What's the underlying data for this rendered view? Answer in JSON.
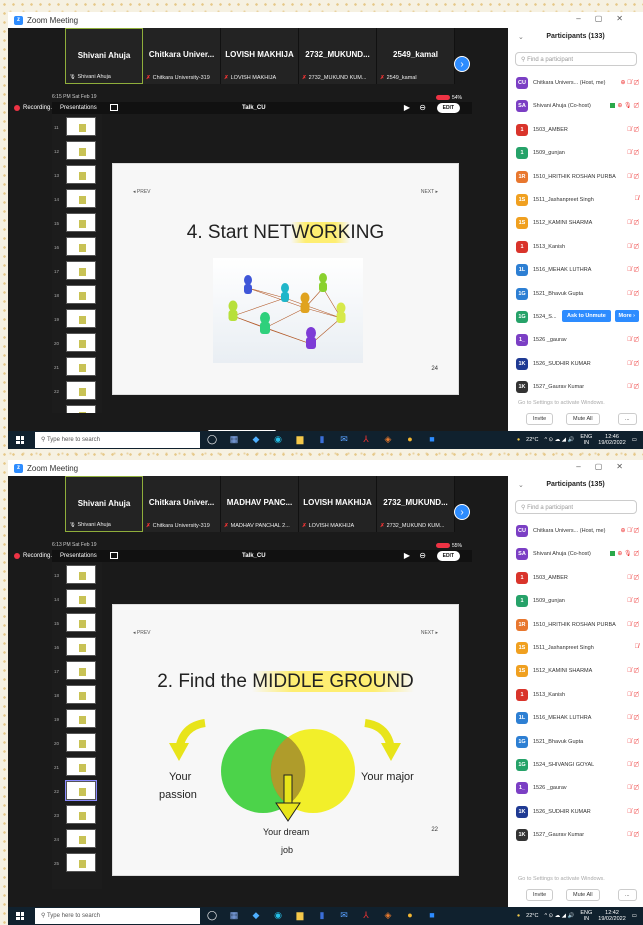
{
  "window_title": "Zoom Meeting",
  "shots": [
    {
      "thumbs": [
        {
          "name": "Shivani Ahuja",
          "sub": "Shivani Ahuja",
          "muted": false
        },
        {
          "name": "Chitkara Univer...",
          "sub": "Chitkara University-319",
          "muted": true
        },
        {
          "name": "LOVISH MAKHIJA",
          "sub": "LOVISH MAKHIJA",
          "muted": true
        },
        {
          "name": "2732_MUKUND...",
          "sub": "2732_MUKUND KUM...",
          "muted": true
        },
        {
          "name": "2549_kamal",
          "sub": "2549_kamal",
          "muted": true
        }
      ],
      "recording": "Recording...",
      "tablet_time": "6:15 PM  Sat Feb 19",
      "tablet_battery": "54%",
      "presentations_label": "Presentations",
      "doc_title": "Talk_CU",
      "edit_label": "EDIT",
      "slide_numbers": [
        "11",
        "12",
        "13",
        "14",
        "15",
        "16",
        "17",
        "18",
        "19",
        "20",
        "21",
        "22",
        "23",
        "24",
        "25"
      ],
      "selected_slide": 13,
      "slide": {
        "prev": "◂  PREV",
        "next": "NEXT  ▸",
        "heading_a": "4. Start NET",
        "heading_hl": "WORK",
        "heading_b": "ING",
        "page": "24"
      },
      "participants_title": "Participants (133)",
      "search_placeholder": "Find a participant",
      "participants": [
        {
          "initials": "CU",
          "color": "#7b3fc4",
          "name": "Chitkara Univers... (Host, me)",
          "icons": "⊕ 🎙̸ ▢̸"
        },
        {
          "initials": "SA",
          "color": "#7b3fc4",
          "name": "Shivani Ahuja (Co-host)",
          "icons": "⊕ 🎙 ▢̸",
          "green": true
        },
        {
          "initials": "1",
          "color": "#d9342b",
          "name": "1503_AMBER",
          "icons": "🎙̸ ▢̸"
        },
        {
          "initials": "1",
          "color": "#26a269",
          "name": "1509_gunjan",
          "icons": "🎙̸ ▢̸"
        },
        {
          "initials": "1R",
          "color": "#e8772e",
          "name": "1510_HRITHIK ROSHAN PURBA",
          "icons": "🎙̸ ▢̸"
        },
        {
          "initials": "1S",
          "color": "#f0a020",
          "name": "1511_Jashanpreet Singh",
          "icons": "🎙̸"
        },
        {
          "initials": "1S",
          "color": "#f0a020",
          "name": "1512_KAMINI SHARMA",
          "icons": "🎙̸ ▢̸"
        },
        {
          "initials": "1",
          "color": "#d9342b",
          "name": "1513_Kanish",
          "icons": "🎙̸ ▢̸"
        },
        {
          "initials": "1L",
          "color": "#2d7fd3",
          "name": "1516_MEHAK LUTHRA",
          "icons": "🎙̸ ▢̸"
        },
        {
          "initials": "1G",
          "color": "#2d7fd3",
          "name": "1521_Bhavuk Gupta",
          "icons": "🎙̸ ▢̸"
        },
        {
          "initials": "1G",
          "color": "#26a269",
          "name": "1524_S...",
          "icons": "",
          "unmute": "Ask to Unmute",
          "more": "More ›"
        },
        {
          "initials": "1_",
          "color": "#7b3fc4",
          "name": "1526 _gaurav",
          "icons": "🎙̸ ▢̸"
        },
        {
          "initials": "1K",
          "color": "#1f3a93",
          "name": "1526_SUDHIR KUMAR",
          "icons": "🎙̸ ▢̸"
        },
        {
          "initials": "1K",
          "color": "#333333",
          "name": "1527_Gaurav Kumar",
          "icons": "🎙̸ ▢̸"
        }
      ],
      "watermark": "Go to Settings to activate Windows.",
      "invite": "Invite",
      "muteall": "Mute All",
      "more_dots": "...",
      "taskbar_search": "Type here to search",
      "weather": "22°C",
      "lang": "ENG",
      "lang2": "IN",
      "time": "12:46",
      "date": "19/02/2022"
    },
    {
      "thumbs": [
        {
          "name": "Shivani Ahuja",
          "sub": "Shivani Ahuja",
          "muted": false
        },
        {
          "name": "Chitkara Univer...",
          "sub": "Chitkara University-319",
          "muted": true
        },
        {
          "name": "MADHAV PANC...",
          "sub": "MADHAV PANCHAL 2...",
          "muted": true
        },
        {
          "name": "LOVISH MAKHIJA",
          "sub": "LOVISH MAKHIJA",
          "muted": true
        },
        {
          "name": "2732_MUKUND...",
          "sub": "2732_MUKUND KUM...",
          "muted": true
        }
      ],
      "recording": "Recording...",
      "tablet_time": "6:13 PM  Sat Feb 19",
      "tablet_battery": "55%",
      "presentations_label": "Presentations",
      "doc_title": "Talk_CU",
      "edit_label": "EDIT",
      "slide_numbers": [
        "13",
        "14",
        "15",
        "16",
        "17",
        "18",
        "19",
        "20",
        "21",
        "22",
        "23",
        "24",
        "25"
      ],
      "selected_slide": 9,
      "slide": {
        "prev": "◂  PREV",
        "next": "NEXT  ▸",
        "heading_a": "2. Find the ",
        "heading_hl": "MIDDLE GROUND",
        "heading_b": "",
        "page": "22",
        "left_label_1": "Your",
        "left_label_2": "passion",
        "right_label": "Your major",
        "bottom_label_1": "Your dream",
        "bottom_label_2": "job"
      },
      "participants_title": "Participants (135)",
      "search_placeholder": "Find a participant",
      "participants": [
        {
          "initials": "CU",
          "color": "#7b3fc4",
          "name": "Chitkara Univers... (Host, me)",
          "icons": "⊕ 🎙̸ ▢̸"
        },
        {
          "initials": "SA",
          "color": "#7b3fc4",
          "name": "Shivani Ahuja (Co-host)",
          "icons": "⊕ 🎙 ▢̸",
          "green": true
        },
        {
          "initials": "1",
          "color": "#d9342b",
          "name": "1503_AMBER",
          "icons": "🎙̸ ▢̸"
        },
        {
          "initials": "1",
          "color": "#26a269",
          "name": "1509_gunjan",
          "icons": "🎙̸ ▢̸"
        },
        {
          "initials": "1R",
          "color": "#e8772e",
          "name": "1510_HRITHIK ROSHAN PURBA",
          "icons": "🎙̸ ▢̸"
        },
        {
          "initials": "1S",
          "color": "#f0a020",
          "name": "1511_Jashanpreet Singh",
          "icons": "🎙̸"
        },
        {
          "initials": "1S",
          "color": "#f0a020",
          "name": "1512_KAMINI SHARMA",
          "icons": "🎙̸ ▢̸"
        },
        {
          "initials": "1",
          "color": "#d9342b",
          "name": "1513_Kanish",
          "icons": "🎙̸ ▢̸"
        },
        {
          "initials": "1L",
          "color": "#2d7fd3",
          "name": "1516_MEHAK LUTHRA",
          "icons": "🎙̸ ▢̸"
        },
        {
          "initials": "1G",
          "color": "#2d7fd3",
          "name": "1521_Bhavuk Gupta",
          "icons": "🎙̸ ▢̸"
        },
        {
          "initials": "1G",
          "color": "#26a269",
          "name": "1524_SHIVANGI GOYAL",
          "icons": "🎙̸ ▢̸"
        },
        {
          "initials": "1_",
          "color": "#7b3fc4",
          "name": "1526 _gaurav",
          "icons": "🎙̸ ▢̸"
        },
        {
          "initials": "1K",
          "color": "#1f3a93",
          "name": "1526_SUDHIR KUMAR",
          "icons": "🎙̸ ▢̸"
        },
        {
          "initials": "1K",
          "color": "#333333",
          "name": "1527_Gaurav Kumar",
          "icons": "🎙̸ ▢̸"
        }
      ],
      "watermark": "Go to Settings to activate Windows.",
      "invite": "Invite",
      "muteall": "Mute All",
      "more_dots": "...",
      "taskbar_search": "Type here to search",
      "weather": "22°C",
      "lang": "ENG",
      "lang2": "IN",
      "time": "12:42",
      "date": "19/02/2022"
    }
  ],
  "colors": {
    "zoom_blue": "#2d8cff",
    "highlight_yellow": "#ffec5a",
    "venn_green": "#4cd34a",
    "venn_yellow": "#f2ef2a",
    "arrow_yellow": "#e8e41a"
  },
  "icons": [
    "zoom-logo-icon",
    "recording-dot-icon",
    "next-page-icon",
    "play-icon",
    "windows-start-icon",
    "search-icon",
    "chevron-down-icon"
  ]
}
